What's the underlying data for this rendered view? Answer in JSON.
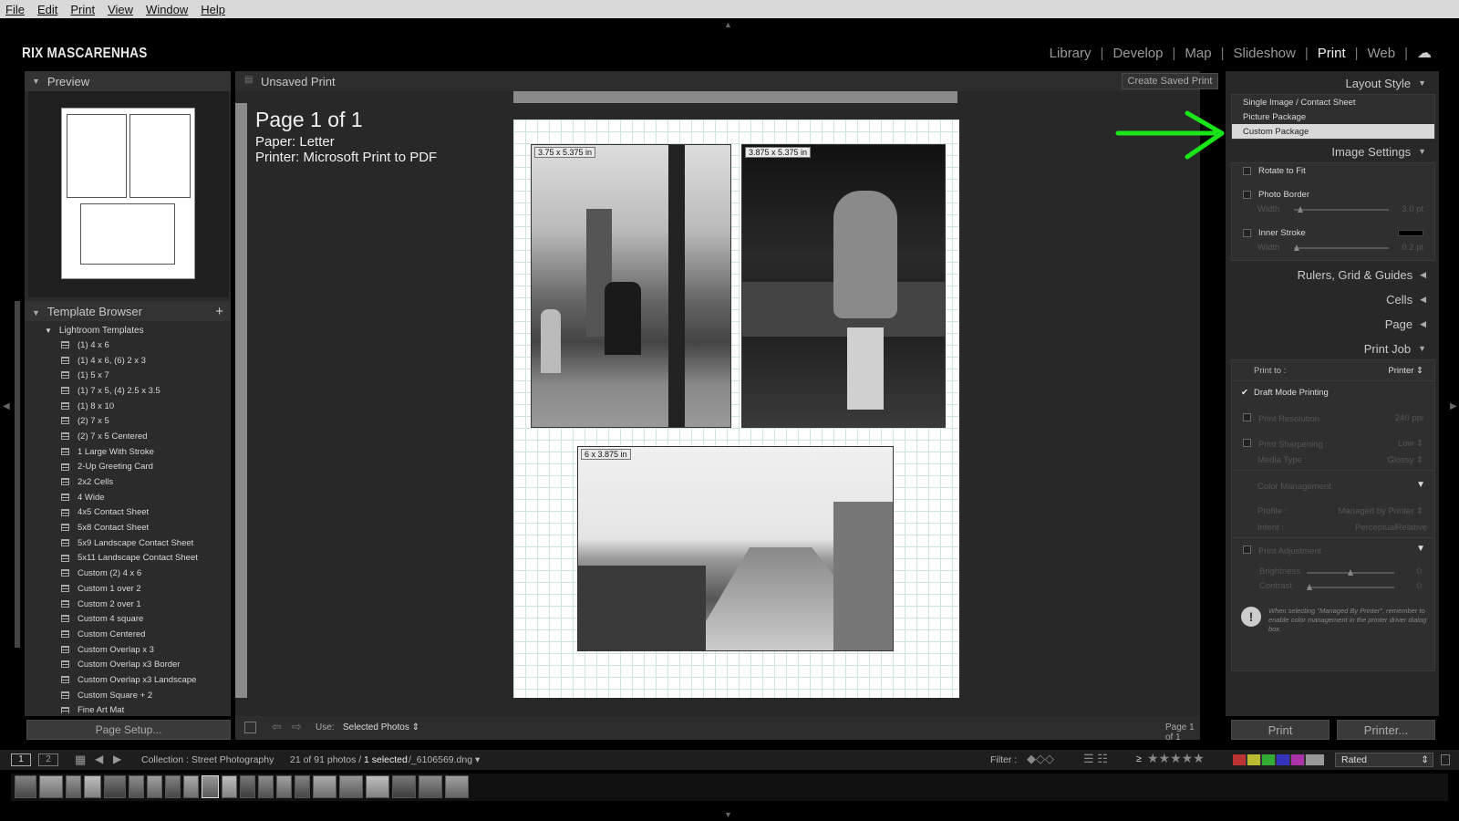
{
  "menu": [
    "File",
    "Edit",
    "Print",
    "View",
    "Window",
    "Help"
  ],
  "identity_plate": "RIX MASCARENHAS",
  "modules": [
    {
      "label": "Library",
      "active": false
    },
    {
      "label": "Develop",
      "active": false
    },
    {
      "label": "Map",
      "active": false
    },
    {
      "label": "Slideshow",
      "active": false
    },
    {
      "label": "Print",
      "active": true
    },
    {
      "label": "Web",
      "active": false
    }
  ],
  "left": {
    "preview_title": "Preview",
    "template_browser_title": "Template Browser",
    "template_folder": "Lightroom Templates",
    "templates": [
      "(1) 4 x 6",
      "(1) 4 x 6, (6) 2 x 3",
      "(1) 5 x 7",
      "(1) 7 x 5, (4) 2.5 x 3.5",
      "(1) 8 x 10",
      "(2) 7 x 5",
      "(2) 7 x 5 Centered",
      "1 Large With Stroke",
      "2-Up Greeting Card",
      "2x2 Cells",
      "4 Wide",
      "4x5 Contact Sheet",
      "5x8 Contact Sheet",
      "5x9 Landscape Contact Sheet",
      "5x11 Landscape Contact Sheet",
      "Custom (2) 4 x 6",
      "Custom 1 over 2",
      "Custom 2 over 1",
      "Custom 4 square",
      "Custom Centered",
      "Custom Overlap x 3",
      "Custom Overlap x3 Border",
      "Custom Overlap x3 Landscape",
      "Custom Square + 2",
      "Fine Art Mat"
    ],
    "page_setup_label": "Page Setup..."
  },
  "center": {
    "title": "Unsaved Print",
    "create_saved_print": "Create Saved Print",
    "page_title": "Page 1 of 1",
    "paper": "Paper:  Letter",
    "printer": "Printer:  Microsoft Print to PDF",
    "cells": [
      "3.75 x 5.375 in",
      "3.875 x 5.375 in",
      "6 x 3.875 in"
    ],
    "footer_use_label": "Use:",
    "footer_use_value": "Selected Photos",
    "footer_page": "Page 1 of 1"
  },
  "right": {
    "layout_style_title": "Layout Style",
    "layout_options": [
      {
        "label": "Single Image / Contact Sheet",
        "selected": false
      },
      {
        "label": "Picture Package",
        "selected": false
      },
      {
        "label": "Custom Package",
        "selected": true
      }
    ],
    "image_settings_title": "Image Settings",
    "rotate_to_fit": "Rotate to Fit",
    "photo_border": "Photo Border",
    "width_label": "Width",
    "photo_border_width": "3.0 pt",
    "inner_stroke": "Inner Stroke",
    "inner_stroke_width": "0.2 pt",
    "rulers_title": "Rulers, Grid & Guides",
    "cells_title": "Cells",
    "page_title": "Page",
    "print_job_title": "Print Job",
    "print_to_label": "Print to :",
    "print_to_value": "Printer",
    "draft_mode": "Draft Mode Printing",
    "print_resolution": "Print Resolution",
    "print_resolution_value": "240  ppi",
    "print_sharpening": "Print Sharpening :",
    "print_sharpening_value": "Low",
    "media_type": "Media Type :",
    "media_type_value": "Glossy",
    "color_management": "Color Management",
    "profile_label": "Profile :",
    "profile_value": "Managed by Printer",
    "intent_label": "Intent :",
    "intent_perceptual": "Perceptual",
    "intent_relative": "Relative",
    "print_adjustment": "Print Adjustment",
    "brightness_label": "Brightness",
    "brightness_value": "0",
    "contrast_label": "Contrast",
    "contrast_value": "0",
    "note": "When selecting \"Managed By Printer\", remember to enable color management in the printer driver dialog box.",
    "print_button": "Print",
    "printer_button": "Printer..."
  },
  "filmstrip": {
    "view1": "1",
    "view2": "2",
    "source": "Collection : Street Photography",
    "count": "21 of 91 photos /",
    "selected": "1 selected",
    "filename": "/_6106569.dng",
    "filter_label": "Filter :",
    "rating_op": "≥",
    "stars": "★★★★★",
    "rated": "Rated"
  },
  "colors": {
    "accent_arrow": "#19e619",
    "selected_row": "#d9d9d9"
  }
}
